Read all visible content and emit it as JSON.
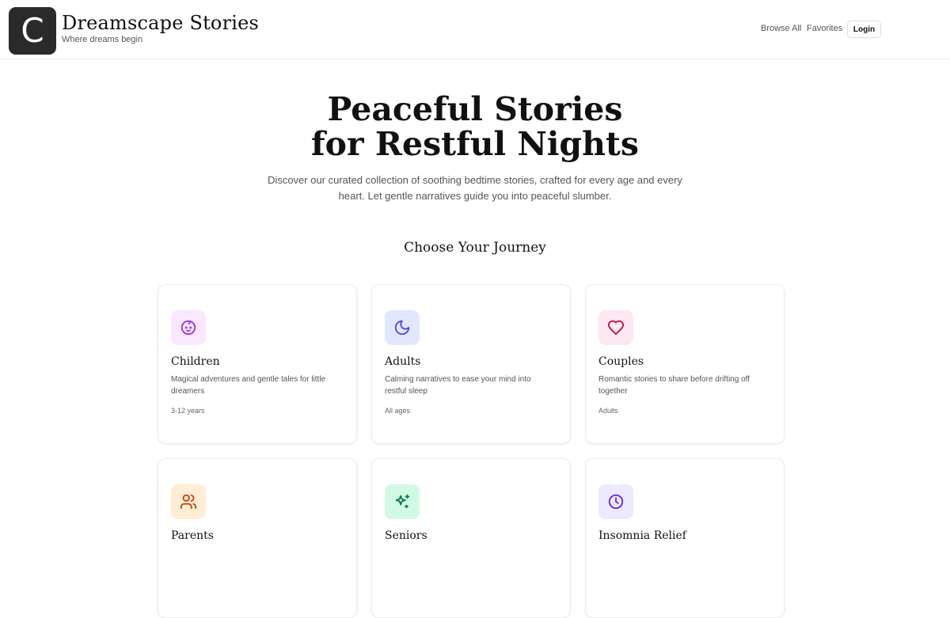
{
  "brand": {
    "logo_letter": "C",
    "title": "Dreamscape Stories",
    "tagline": "Where dreams begin"
  },
  "nav": {
    "browse_all": "Browse All",
    "favorites": "Favorites",
    "login": "Login"
  },
  "hero": {
    "title_line1": "Peaceful Stories",
    "title_line2": "for Restful Nights",
    "subtitle": "Discover our curated collection of soothing bedtime stories, crafted for every age and every heart. Let gentle narratives guide you into peaceful slumber."
  },
  "section": {
    "title": "Choose Your Journey"
  },
  "cards": [
    {
      "title": "Children",
      "description": "Magical adventures and gentle tales for little dreamers",
      "meta": "3-12 years",
      "icon": "baby-face-icon",
      "icon_bg": "#fae8ff",
      "icon_color": "#9333ea"
    },
    {
      "title": "Adults",
      "description": "Calming narratives to ease your mind into restful sleep",
      "meta": "All ages",
      "icon": "moon-icon",
      "icon_bg": "#e0e7ff",
      "icon_color": "#4f46e5"
    },
    {
      "title": "Couples",
      "description": "Romantic stories to share before drifting off together",
      "meta": "Adults",
      "icon": "heart-icon",
      "icon_bg": "#fce7f3",
      "icon_color": "#be123c"
    },
    {
      "title": "Parents",
      "description": "",
      "meta": "",
      "icon": "users-icon",
      "icon_bg": "#ffedd5",
      "icon_color": "#c2410c"
    },
    {
      "title": "Seniors",
      "description": "",
      "meta": "",
      "icon": "sparkles-icon",
      "icon_bg": "#d1fae5",
      "icon_color": "#047857"
    },
    {
      "title": "Insomnia Relief",
      "description": "",
      "meta": "",
      "icon": "clock-icon",
      "icon_bg": "#ede9fe",
      "icon_color": "#6d28d9"
    }
  ]
}
